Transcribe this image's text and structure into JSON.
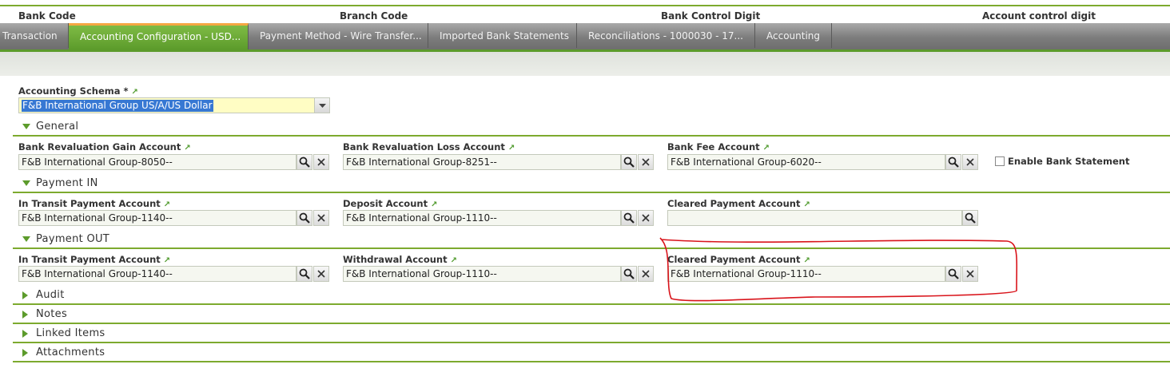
{
  "header": {
    "bank_code": "Bank Code",
    "branch_code": "Branch Code",
    "bank_control_digit": "Bank Control Digit",
    "account_control_digit": "Account control digit"
  },
  "tabs": [
    {
      "label": "Transaction",
      "active": false
    },
    {
      "label": "Accounting Configuration - USD...",
      "active": true
    },
    {
      "label": "Payment Method - Wire Transfer...",
      "active": false
    },
    {
      "label": "Imported Bank Statements",
      "active": false
    },
    {
      "label": "Reconciliations - 1000030 - 17...",
      "active": false
    },
    {
      "label": "Accounting",
      "active": false
    }
  ],
  "form": {
    "accounting_schema": {
      "label": "Accounting Schema *",
      "value": "F&B International Group US/A/US Dollar"
    },
    "sections": {
      "general": "General",
      "payment_in": "Payment IN",
      "payment_out": "Payment OUT",
      "audit": "Audit",
      "notes": "Notes",
      "linked_items": "Linked Items",
      "attachments": "Attachments"
    },
    "general": {
      "revaluation_gain": {
        "label": "Bank Revaluation Gain Account",
        "value": "F&B International Group-8050--"
      },
      "revaluation_loss": {
        "label": "Bank Revaluation Loss Account",
        "value": "F&B International Group-8251--"
      },
      "bank_fee": {
        "label": "Bank Fee Account",
        "value": "F&B International Group-6020--"
      },
      "enable_bank_statement": {
        "label": "Enable Bank Statement",
        "checked": false
      }
    },
    "payment_in": {
      "in_transit": {
        "label": "In Transit Payment Account",
        "value": "F&B International Group-1140--"
      },
      "deposit": {
        "label": "Deposit Account",
        "value": "F&B International Group-1110--"
      },
      "cleared": {
        "label": "Cleared Payment Account",
        "value": ""
      }
    },
    "payment_out": {
      "in_transit": {
        "label": "In Transit Payment Account",
        "value": "F&B International Group-1140--"
      },
      "withdrawal": {
        "label": "Withdrawal Account",
        "value": "F&B International Group-1110--"
      },
      "cleared": {
        "label": "Cleared Payment Account",
        "value": "F&B International Group-1110--"
      }
    }
  },
  "icons": {
    "search": "magnifier-icon",
    "clear": "x-icon",
    "link": "jump-arrow-icon",
    "expanded": "triangle-down-icon",
    "collapsed": "triangle-right-icon"
  },
  "colors": {
    "accent_green": "#7daa2e",
    "active_tab": "#6aa935",
    "active_tab_top": "#f6a742",
    "annotation": "#d9141b",
    "selection": "#3778d3"
  }
}
